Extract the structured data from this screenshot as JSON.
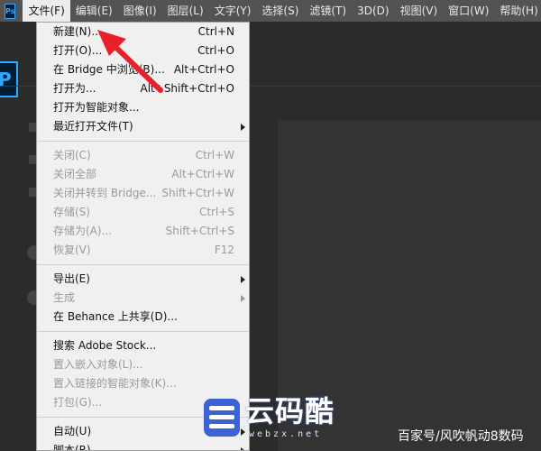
{
  "menubar": {
    "app_icon": "Ps",
    "items": [
      "文件(F)",
      "编辑(E)",
      "图像(I)",
      "图层(L)",
      "文字(Y)",
      "选择(S)",
      "滤镜(T)",
      "3D(D)",
      "视图(V)",
      "窗口(W)",
      "帮助(H)"
    ]
  },
  "workspace": {
    "logo_text": "P"
  },
  "file_menu": {
    "rows": [
      {
        "label": "新建(N)...",
        "shortcut": "Ctrl+N",
        "disabled": false,
        "submenu": false
      },
      {
        "label": "打开(O)...",
        "shortcut": "Ctrl+O",
        "disabled": false,
        "submenu": false
      },
      {
        "label": "在 Bridge 中浏览(B)...",
        "shortcut": "Alt+Ctrl+O",
        "disabled": false,
        "submenu": false
      },
      {
        "label": "打开为...",
        "shortcut": "Alt+Shift+Ctrl+O",
        "disabled": false,
        "submenu": false
      },
      {
        "label": "打开为智能对象...",
        "shortcut": "",
        "disabled": false,
        "submenu": false
      },
      {
        "label": "最近打开文件(T)",
        "shortcut": "",
        "disabled": false,
        "submenu": true
      },
      {
        "sep": true
      },
      {
        "label": "关闭(C)",
        "shortcut": "Ctrl+W",
        "disabled": true,
        "submenu": false
      },
      {
        "label": "关闭全部",
        "shortcut": "Alt+Ctrl+W",
        "disabled": true,
        "submenu": false
      },
      {
        "label": "关闭并转到 Bridge...",
        "shortcut": "Shift+Ctrl+W",
        "disabled": true,
        "submenu": false
      },
      {
        "label": "存储(S)",
        "shortcut": "Ctrl+S",
        "disabled": true,
        "submenu": false
      },
      {
        "label": "存储为(A)...",
        "shortcut": "Shift+Ctrl+S",
        "disabled": true,
        "submenu": false
      },
      {
        "label": "恢复(V)",
        "shortcut": "F12",
        "disabled": true,
        "submenu": false
      },
      {
        "sep": true
      },
      {
        "label": "导出(E)",
        "shortcut": "",
        "disabled": false,
        "submenu": true
      },
      {
        "label": "生成",
        "shortcut": "",
        "disabled": true,
        "submenu": true
      },
      {
        "label": "在 Behance 上共享(D)...",
        "shortcut": "",
        "disabled": false,
        "submenu": false
      },
      {
        "sep": true
      },
      {
        "label": "搜索 Adobe Stock...",
        "shortcut": "",
        "disabled": false,
        "submenu": false
      },
      {
        "label": "置入嵌入对象(L)...",
        "shortcut": "",
        "disabled": true,
        "submenu": false
      },
      {
        "label": "置入链接的智能对象(K)...",
        "shortcut": "",
        "disabled": true,
        "submenu": false
      },
      {
        "label": "打包(G)...",
        "shortcut": "",
        "disabled": true,
        "submenu": false
      },
      {
        "sep": true
      },
      {
        "label": "自动(U)",
        "shortcut": "",
        "disabled": false,
        "submenu": true
      },
      {
        "label": "脚本(R)",
        "shortcut": "",
        "disabled": false,
        "submenu": true
      }
    ]
  },
  "colors": {
    "annotation_arrow": "#e8202a",
    "menubar": "#535353",
    "menu_bg": "#f0f0f0"
  },
  "watermark": {
    "brand": "云码酷",
    "sub": "webzx.net",
    "author": "百家号/风吹帆动8数码"
  }
}
